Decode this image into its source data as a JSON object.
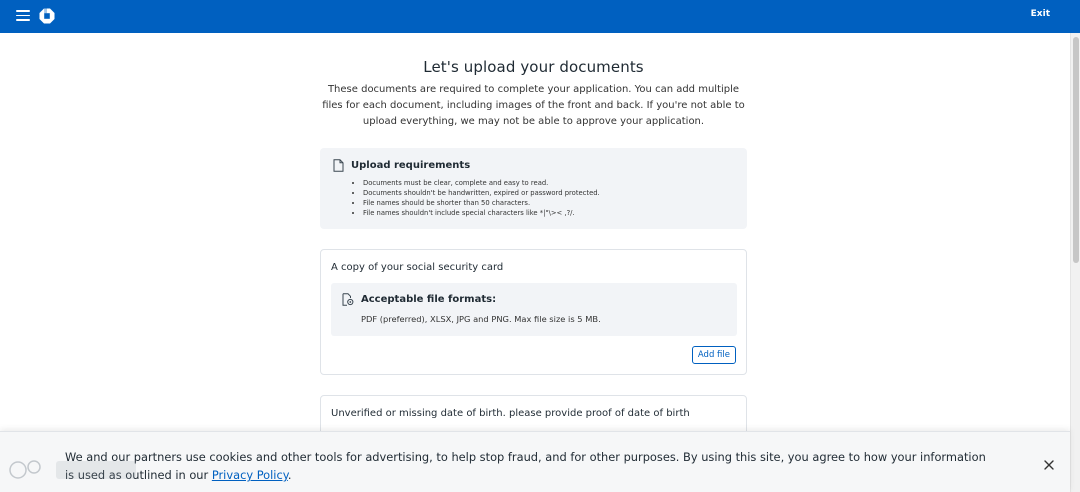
{
  "header": {
    "menu_icon": "hamburger-menu-icon",
    "logo_icon": "octagon-logo-icon",
    "exit_label": "Exit",
    "background": "#0060c0"
  },
  "main": {
    "title": "Let's upload your documents",
    "intro": "These documents are required to complete your application. You can add multiple files for each document, including images of the front and back. If you're not able to upload everything, we may not be able to approve your application."
  },
  "requirements": {
    "icon": "document-icon",
    "title": "Upload requirements",
    "items": [
      "Documents must be clear, complete and easy to read.",
      "Documents shouldn't be handwritten, expired or password protected.",
      "File names should be shorter than 50 characters.",
      "File names shouldn't include special characters like *|\"\\>< ,?/."
    ]
  },
  "cards": [
    {
      "title": "A copy of your social security card",
      "formats_icon": "file-settings-icon",
      "formats_title": "Acceptable file formats:",
      "formats_text": "PDF (preferred), XLSX, JPG and PNG. Max file size is 5 MB.",
      "button_label": "Add file"
    },
    {
      "title": "Unverified or missing date of birth. please provide proof of date of birth"
    }
  ],
  "cookie_banner": {
    "text": "We and our partners use cookies and other tools for advertising, to help stop fraud, and for other purposes. By using this site, you agree to how your information is used as outlined in our ",
    "link_label": "Privacy Policy",
    "text_end": ".",
    "close_icon": "close-icon"
  },
  "colors": {
    "accent": "#0060c0",
    "panel": "#f2f4f7"
  }
}
